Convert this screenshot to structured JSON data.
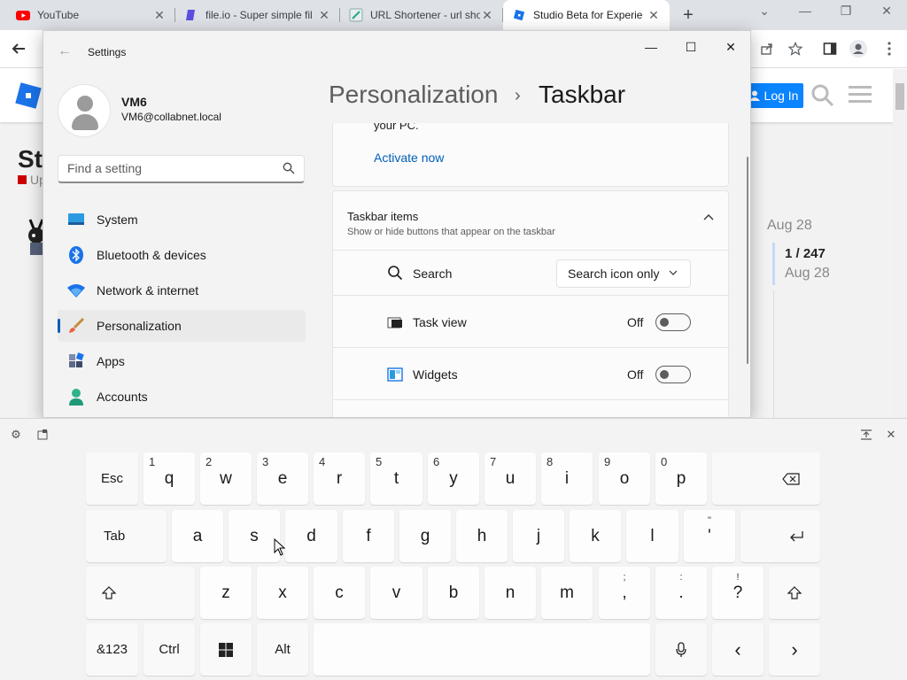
{
  "browser": {
    "tabs": [
      {
        "title": "YouTube",
        "icon": "youtube-icon"
      },
      {
        "title": "file.io - Super simple fil",
        "icon": "fileio-icon"
      },
      {
        "title": "URL Shortener - url sho",
        "icon": "url-shortener-icon"
      },
      {
        "title": "Studio Beta for Experie",
        "icon": "roblox-icon"
      }
    ],
    "new_tab": "+",
    "window_controls": [
      "⌄",
      "—",
      "❐",
      "✕"
    ]
  },
  "roblox_page": {
    "login_label": "Log In",
    "heading_fragment": "St",
    "sub_fragment": "Up",
    "date_top": "Aug 28",
    "progress": "1 / 247",
    "date_bottom": "Aug 28"
  },
  "settings": {
    "window_title": "Settings",
    "user": {
      "name": "VM6",
      "email": "VM6@collabnet.local"
    },
    "search_placeholder": "Find a setting",
    "nav": [
      {
        "label": "System",
        "icon": "system-icon"
      },
      {
        "label": "Bluetooth & devices",
        "icon": "bluetooth-icon"
      },
      {
        "label": "Network & internet",
        "icon": "wifi-icon"
      },
      {
        "label": "Personalization",
        "icon": "brush-icon",
        "selected": true
      },
      {
        "label": "Apps",
        "icon": "apps-icon"
      },
      {
        "label": "Accounts",
        "icon": "accounts-icon"
      }
    ],
    "breadcrumb": {
      "parent": "Personalization",
      "separator": "›",
      "current": "Taskbar"
    },
    "activate": {
      "text_fragment": "your PC.",
      "link": "Activate now"
    },
    "taskbar_items": {
      "title": "Taskbar items",
      "subtitle": "Show or hide buttons that appear on the taskbar",
      "rows": [
        {
          "label": "Search",
          "icon": "search-icon",
          "control": "dropdown",
          "value": "Search icon only"
        },
        {
          "label": "Task view",
          "icon": "task-view-icon",
          "control": "toggle",
          "state": "Off"
        },
        {
          "label": "Widgets",
          "icon": "widgets-icon",
          "control": "toggle",
          "state": "Off"
        }
      ]
    },
    "accent_color": "#005fb8"
  },
  "keyboard": {
    "row1": [
      {
        "main": "Esc"
      },
      {
        "main": "q",
        "num": "1"
      },
      {
        "main": "w",
        "num": "2"
      },
      {
        "main": "e",
        "num": "3"
      },
      {
        "main": "r",
        "num": "4"
      },
      {
        "main": "t",
        "num": "5"
      },
      {
        "main": "y",
        "num": "6"
      },
      {
        "main": "u",
        "num": "7"
      },
      {
        "main": "i",
        "num": "8"
      },
      {
        "main": "o",
        "num": "9"
      },
      {
        "main": "p",
        "num": "0"
      }
    ],
    "row2": [
      {
        "main": "Tab"
      },
      {
        "main": "a"
      },
      {
        "main": "s"
      },
      {
        "main": "d"
      },
      {
        "main": "f"
      },
      {
        "main": "g"
      },
      {
        "main": "h"
      },
      {
        "main": "j"
      },
      {
        "main": "k"
      },
      {
        "main": "l"
      },
      {
        "main": "'",
        "sym": "\""
      }
    ],
    "row3": [
      {
        "main": "z"
      },
      {
        "main": "x"
      },
      {
        "main": "c"
      },
      {
        "main": "v"
      },
      {
        "main": "b"
      },
      {
        "main": "n"
      },
      {
        "main": "m"
      },
      {
        "main": ",",
        "sym": ";"
      },
      {
        "main": ".",
        "sym": ":"
      },
      {
        "main": "?",
        "sym": "!"
      }
    ],
    "row4": {
      "symbols": "&123",
      "ctrl": "Ctrl",
      "alt": "Alt",
      "left": "‹",
      "right": "›"
    }
  }
}
